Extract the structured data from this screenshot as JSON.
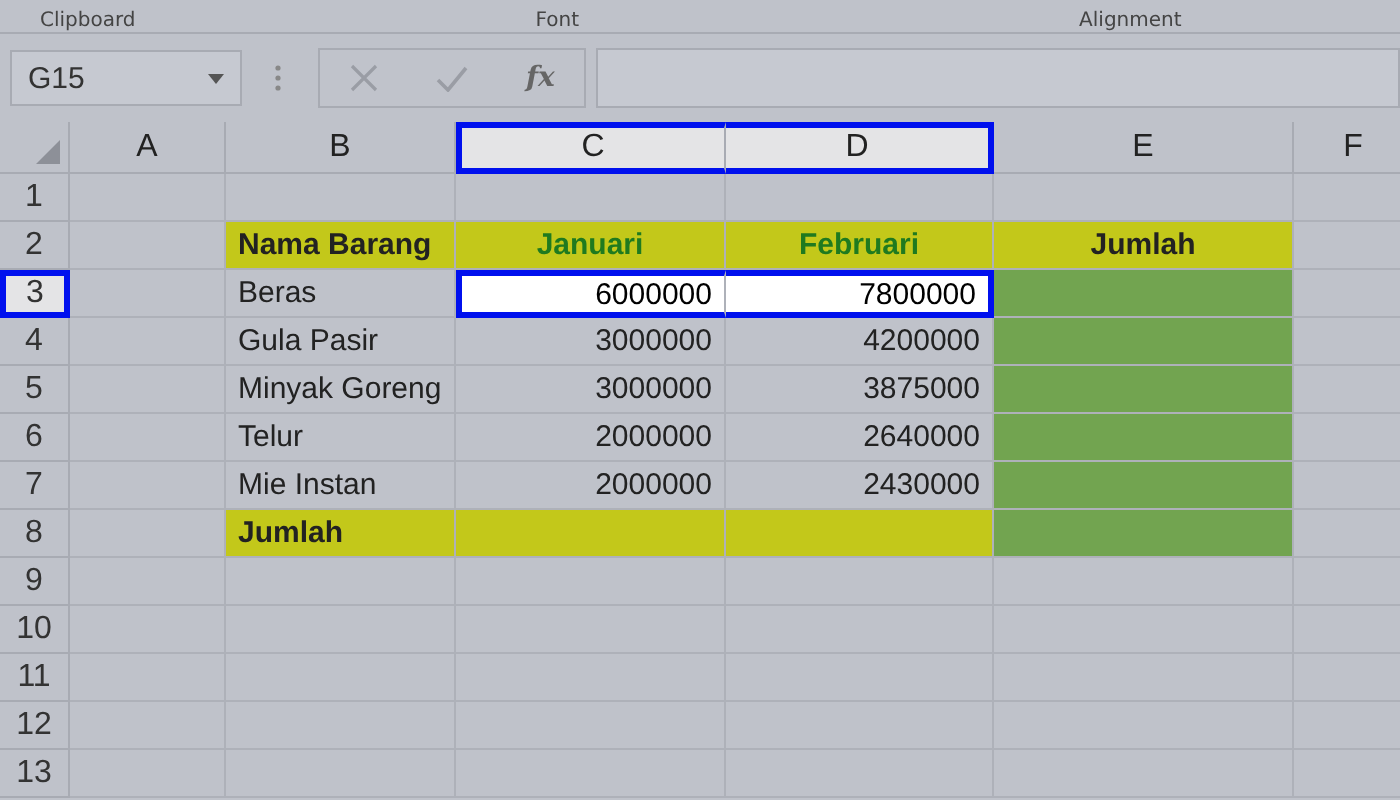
{
  "ribbon_groups": [
    {
      "label": "Clipboard"
    },
    {
      "label": "Font"
    },
    {
      "label": "Alignment"
    }
  ],
  "formula_bar": {
    "name_box": "G15",
    "fx": "fx"
  },
  "columns": [
    {
      "label": "A",
      "selected": false
    },
    {
      "label": "B",
      "selected": false
    },
    {
      "label": "C",
      "selected": true
    },
    {
      "label": "D",
      "selected": true
    },
    {
      "label": "E",
      "selected": false
    },
    {
      "label": "F",
      "selected": false
    }
  ],
  "rows": [
    {
      "label": "1",
      "selected": false,
      "cells": [
        {},
        {},
        {},
        {},
        {},
        {}
      ]
    },
    {
      "label": "2",
      "selected": false,
      "cells": [
        {},
        {
          "kind": "header",
          "text": "Nama Barang"
        },
        {
          "kind": "month",
          "text": "Januari"
        },
        {
          "kind": "month",
          "text": "Februari"
        },
        {
          "kind": "sumhead",
          "text": "Jumlah"
        },
        {}
      ]
    },
    {
      "label": "3",
      "selected": true,
      "cells": [
        {},
        {
          "kind": "text",
          "text": "Beras"
        },
        {
          "kind": "number",
          "text": "6000000",
          "selected": true
        },
        {
          "kind": "number",
          "text": "7800000",
          "selected": true
        },
        {
          "kind": "sum"
        },
        {}
      ]
    },
    {
      "label": "4",
      "selected": false,
      "cells": [
        {},
        {
          "kind": "text",
          "text": "Gula Pasir"
        },
        {
          "kind": "number",
          "text": "3000000"
        },
        {
          "kind": "number",
          "text": "4200000"
        },
        {
          "kind": "sum"
        },
        {}
      ]
    },
    {
      "label": "5",
      "selected": false,
      "cells": [
        {},
        {
          "kind": "text",
          "text": "Minyak Goreng"
        },
        {
          "kind": "number",
          "text": "3000000"
        },
        {
          "kind": "number",
          "text": "3875000"
        },
        {
          "kind": "sum"
        },
        {}
      ]
    },
    {
      "label": "6",
      "selected": false,
      "cells": [
        {},
        {
          "kind": "text",
          "text": "Telur"
        },
        {
          "kind": "number",
          "text": "2000000"
        },
        {
          "kind": "number",
          "text": "2640000"
        },
        {
          "kind": "sum"
        },
        {}
      ]
    },
    {
      "label": "7",
      "selected": false,
      "cells": [
        {},
        {
          "kind": "text",
          "text": "Mie Instan"
        },
        {
          "kind": "number",
          "text": "2000000"
        },
        {
          "kind": "number",
          "text": "2430000"
        },
        {
          "kind": "sum"
        },
        {}
      ]
    },
    {
      "label": "8",
      "selected": false,
      "cells": [
        {},
        {
          "kind": "header",
          "text": "Jumlah"
        },
        {
          "kind": "band"
        },
        {
          "kind": "band"
        },
        {
          "kind": "sum"
        },
        {}
      ]
    },
    {
      "label": "9",
      "selected": false,
      "cells": [
        {},
        {},
        {},
        {},
        {},
        {}
      ]
    },
    {
      "label": "10",
      "selected": false,
      "cells": [
        {},
        {},
        {},
        {},
        {},
        {}
      ]
    },
    {
      "label": "11",
      "selected": false,
      "cells": [
        {},
        {},
        {},
        {},
        {},
        {}
      ]
    },
    {
      "label": "12",
      "selected": false,
      "cells": [
        {},
        {},
        {},
        {},
        {},
        {}
      ]
    },
    {
      "label": "13",
      "selected": false,
      "cells": [
        {},
        {},
        {},
        {},
        {},
        {}
      ]
    }
  ]
}
